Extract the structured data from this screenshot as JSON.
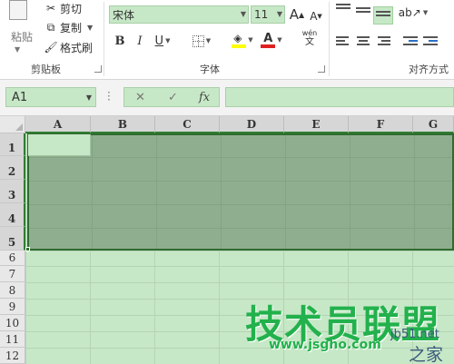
{
  "ribbon": {
    "clipboard": {
      "paste_label": "粘贴",
      "cut_label": "剪切",
      "copy_label": "复制",
      "format_painter_label": "格式刷",
      "group_label": "剪贴板"
    },
    "font": {
      "font_name": "宋体",
      "font_size": "11",
      "grow_label": "A",
      "shrink_label": "A",
      "bold_label": "B",
      "italic_label": "I",
      "underline_label": "U",
      "font_color_label": "A",
      "phonetic_top": "wén",
      "phonetic_bottom": "文",
      "group_label": "字体",
      "highlight_color": "#ffff00",
      "font_color": "#e02020"
    },
    "alignment": {
      "group_label": "对齐方式"
    }
  },
  "formula_bar": {
    "name_box": "A1",
    "cancel_icon_char": "✕",
    "enter_icon_char": "✓",
    "fx_label": "fx",
    "formula_value": ""
  },
  "sheet": {
    "columns": [
      "A",
      "B",
      "C",
      "D",
      "E",
      "F",
      "G"
    ],
    "rows": [
      "1",
      "2",
      "3",
      "4",
      "5",
      "6",
      "7",
      "8",
      "9",
      "10",
      "11",
      "12"
    ],
    "selected_range": "A1:G5",
    "active_cell": "A1",
    "selection_color": "#8fae8f",
    "cell_background": "#c7e8c7"
  },
  "watermark": {
    "main": "技术员联盟",
    "url": "www.jsgho.com",
    "corner_top": "jb51.net",
    "corner_bottom": "之家"
  }
}
